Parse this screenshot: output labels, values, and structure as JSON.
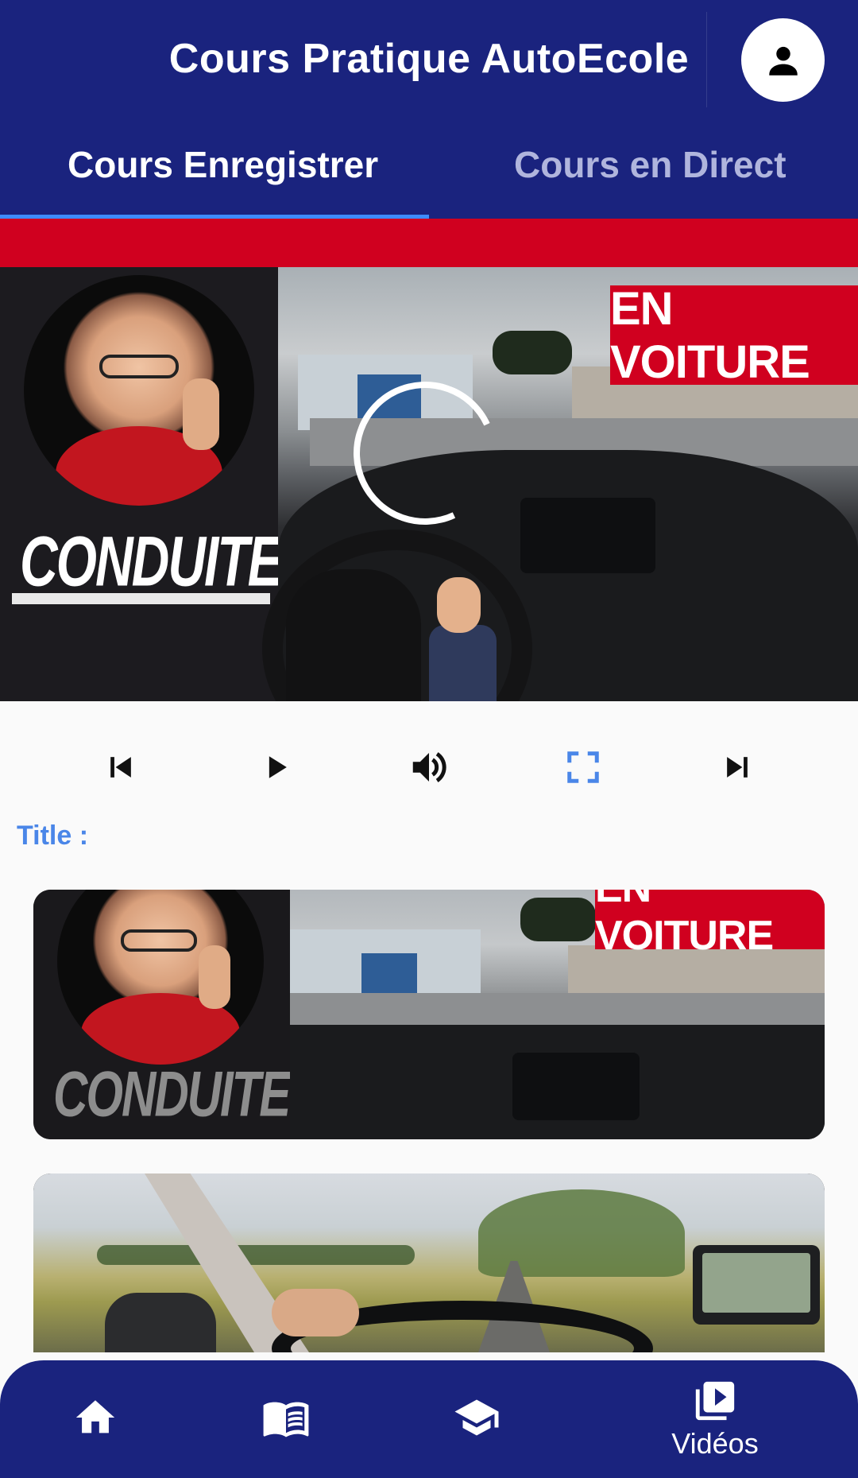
{
  "app": {
    "title": "Cours Pratique AutoEcole",
    "account_icon": "person-icon"
  },
  "tabs": [
    {
      "label": "Cours Enregistrer",
      "selected": true
    },
    {
      "label": "Cours en Direct",
      "selected": false
    }
  ],
  "player": {
    "thumbnail_text": "CONDUITE",
    "badge_text": "EN VOITURE",
    "loading": true,
    "controls": {
      "previous_icon": "skip-previous-icon",
      "play_icon": "play-icon",
      "volume_icon": "volume-icon",
      "fullscreen_icon": "fullscreen-icon",
      "next_icon": "skip-next-icon"
    }
  },
  "now_playing": {
    "title_label": "Title :",
    "title_value": ""
  },
  "videos": [
    {
      "thumbnail_text": "CONDUITE",
      "badge_text": "EN VOITURE"
    },
    {
      "thumbnail_text": "",
      "badge_text": ""
    }
  ],
  "bottom_nav": {
    "items": [
      {
        "icon": "home-icon",
        "label": "",
        "active": false
      },
      {
        "icon": "book-icon",
        "label": "",
        "active": false
      },
      {
        "icon": "school-icon",
        "label": "",
        "active": false
      },
      {
        "icon": "video-library-icon",
        "label": "Vidéos",
        "active": true
      }
    ]
  },
  "colors": {
    "primary": "#1a237e",
    "accent": "#3d8bff",
    "red": "#d0001f",
    "label_blue": "#4a86e8"
  }
}
